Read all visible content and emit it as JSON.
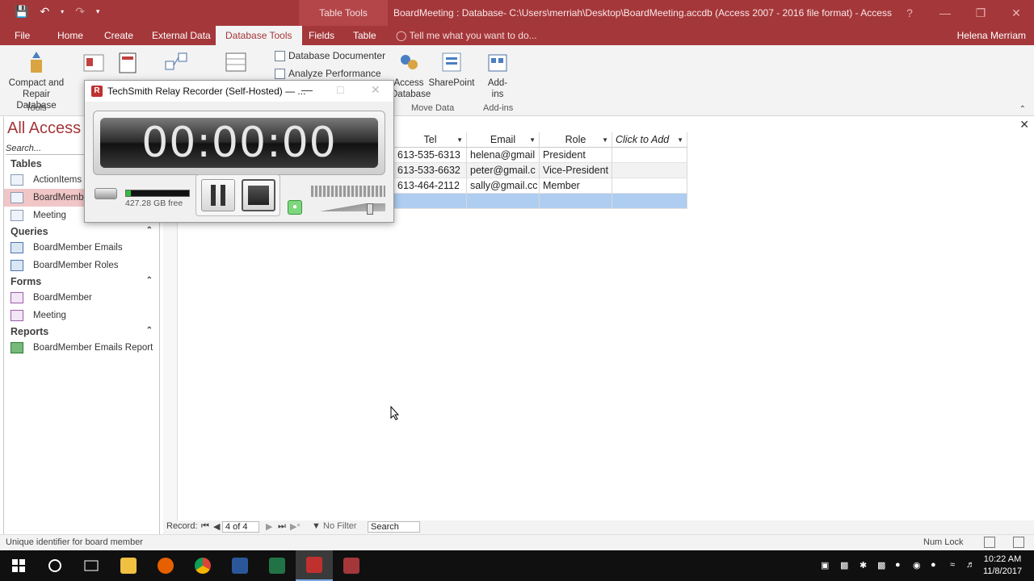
{
  "window": {
    "title": "BoardMeeting : Database- C:\\Users\\merriah\\Desktop\\BoardMeeting.accdb (Access 2007 - 2016 file format) - Access",
    "context_tab": "Table Tools",
    "user": "Helena Merriam"
  },
  "ribbon": {
    "tabs": [
      "File",
      "Home",
      "Create",
      "External Data",
      "Database Tools",
      "Fields",
      "Table"
    ],
    "active_tab": "Database Tools",
    "tell_me": "Tell me what you want to do...",
    "compact_label": "Compact and Repair Database",
    "tools_group": "Tools",
    "database_documenter": "Database Documenter",
    "analyze_performance": "Analyze Performance",
    "access_database": "Access Database",
    "sharepoint": "SharePoint",
    "move_data_group": "Move Data",
    "addins": "Add-ins",
    "addins_group": "Add-ins"
  },
  "nav": {
    "header": "All Access Objects",
    "search_placeholder": "Search...",
    "categories": [
      {
        "label": "Tables",
        "items": [
          "ActionItems",
          "BoardMember",
          "Meeting"
        ]
      },
      {
        "label": "Queries",
        "items": [
          "BoardMember Emails",
          "BoardMember Roles"
        ]
      },
      {
        "label": "Forms",
        "items": [
          "BoardMember",
          "Meeting"
        ]
      },
      {
        "label": "Reports",
        "items": [
          "BoardMember Emails Report"
        ]
      }
    ],
    "selected": "BoardMember"
  },
  "table": {
    "columns": [
      "Tel",
      "Email",
      "Role",
      "Click to Add"
    ],
    "rows": [
      [
        "613-535-6313",
        "helena@gmail",
        "President",
        ""
      ],
      [
        "613-533-6632",
        "peter@gmail.c",
        "Vice-President",
        ""
      ],
      [
        "613-464-2112",
        "sally@gmail.cc",
        "Member",
        ""
      ]
    ]
  },
  "record_nav": {
    "label": "Record:",
    "current": "4 of 4",
    "filter": "No Filter",
    "search": "Search"
  },
  "status": {
    "message": "Unique identifier for board member",
    "num_lock": "Num Lock"
  },
  "recorder": {
    "title": "TechSmith Relay Recorder (Self-Hosted) — ...",
    "timer": "00:00:00",
    "disk_free": "427.28 GB free",
    "disk_fraction": 0.08,
    "volume_fraction": 0.82
  },
  "taskbar": {
    "time": "10:22 AM",
    "date": "11/8/2017"
  },
  "colors": {
    "access_accent": "#a4373a",
    "selection": "#aecdf0",
    "nav_selected": "#f1c6c7"
  }
}
